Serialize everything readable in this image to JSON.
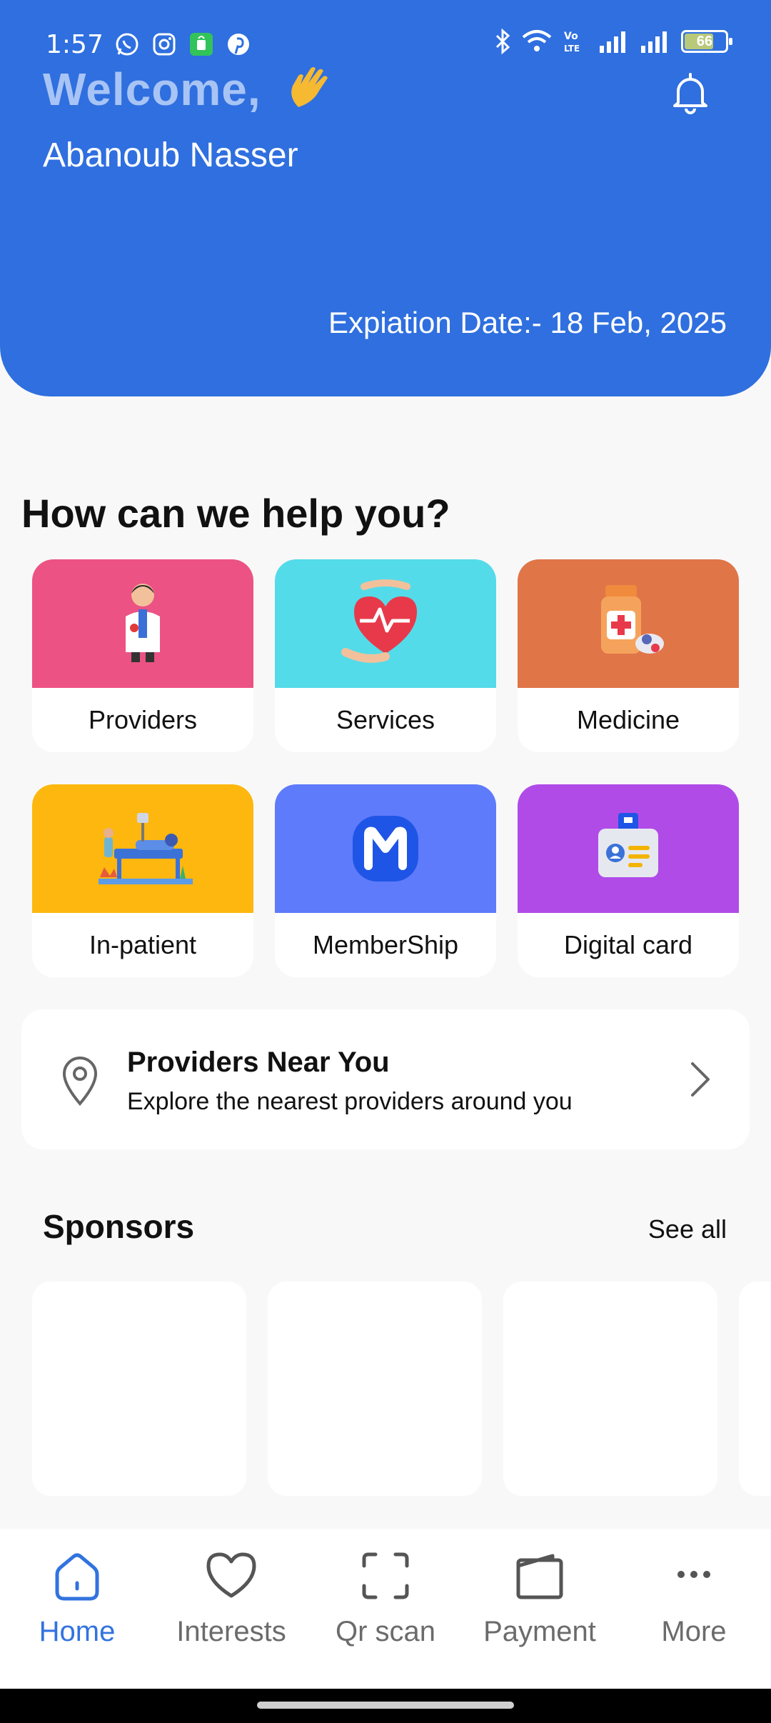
{
  "status_bar": {
    "time": "1:57",
    "battery": "66"
  },
  "header": {
    "welcome": "Welcome,",
    "user_name": "Abanoub Nasser",
    "expiry": "Expiation Date:- 18 Feb, 2025",
    "background_color": "#2f6fdf"
  },
  "help": {
    "title": "How can we help you?",
    "tiles": [
      {
        "label": "Providers",
        "color": "#ec5283",
        "icon": "doctor-icon"
      },
      {
        "label": "Services",
        "color": "#54dbe9",
        "icon": "heart-care-icon"
      },
      {
        "label": "Medicine",
        "color": "#e07548",
        "icon": "medicine-bottle-icon"
      },
      {
        "label": "In-patient",
        "color": "#fdb70f",
        "icon": "hospital-bed-icon"
      },
      {
        "label": "MemberShip",
        "color": "#5e7bfb",
        "icon": "membership-logo-icon"
      },
      {
        "label": "Digital card",
        "color": "#b04be8",
        "icon": "id-badge-icon"
      }
    ]
  },
  "providers_near": {
    "title": "Providers Near You",
    "subtitle": "Explore the nearest providers around you"
  },
  "sponsors": {
    "title": "Sponsors",
    "see_all": "See all"
  },
  "bottom_nav": {
    "items": [
      {
        "label": "Home",
        "icon": "home-icon",
        "active": true
      },
      {
        "label": "Interests",
        "icon": "heart-icon",
        "active": false
      },
      {
        "label": "Qr scan",
        "icon": "qr-scan-icon",
        "active": false
      },
      {
        "label": "Payment",
        "icon": "wallet-icon",
        "active": false
      },
      {
        "label": "More",
        "icon": "more-dots-icon",
        "active": false
      }
    ],
    "active_color": "#3173df"
  }
}
